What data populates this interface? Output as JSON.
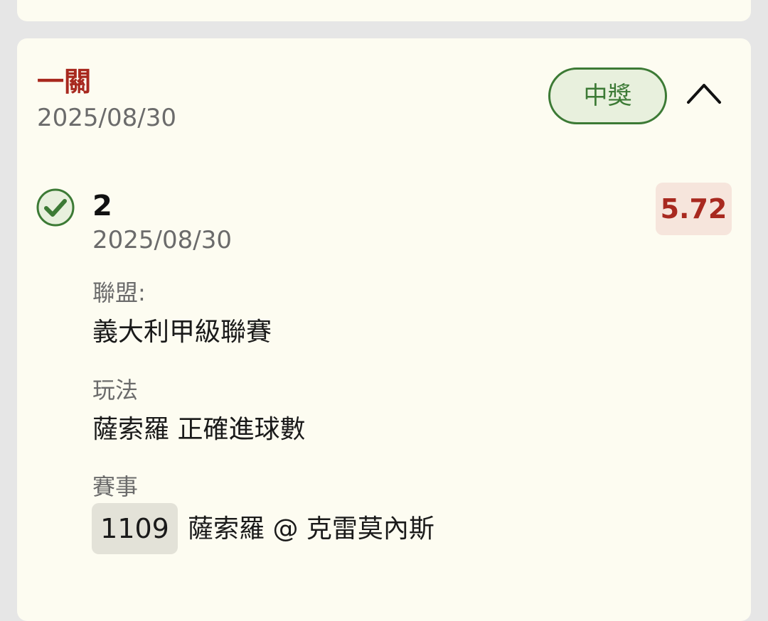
{
  "bet": {
    "type": "一關",
    "date": "2025/08/30",
    "status": "中獎",
    "colors": {
      "accent_red": "#a8291f",
      "status_green": "#3c7a35",
      "card_bg": "#fdfcf1"
    }
  },
  "selection": {
    "icon": "check-circle-icon",
    "value": "2",
    "date": "2025/08/30",
    "odds": "5.72"
  },
  "league": {
    "label": "聯盟:",
    "value": "義大利甲級聯賽"
  },
  "play": {
    "label": "玩法",
    "value": "薩索羅 正確進球數"
  },
  "match": {
    "label": "賽事",
    "number": "1109",
    "teams": "薩索羅 @ 克雷莫內斯"
  },
  "collapse_icon": "chevron-up-icon"
}
